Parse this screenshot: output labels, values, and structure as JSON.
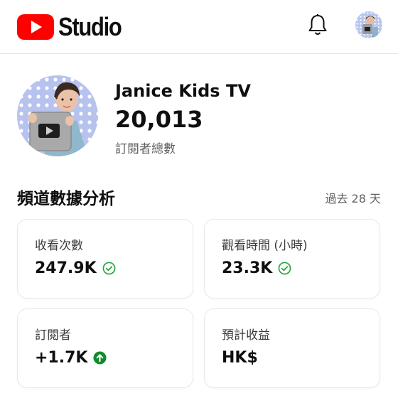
{
  "header": {
    "brand_label": "Studio",
    "logo_icon": "youtube-play-icon",
    "brand_color": "#ff0000",
    "notifications_icon": "bell-icon",
    "account_icon": "avatar"
  },
  "channel": {
    "name": "Janice Kids TV",
    "subscriber_count": "20,013",
    "subscriber_label": "訂閱者總數"
  },
  "analytics": {
    "title": "頻道數據分析",
    "period": "過去 28 天",
    "cards": [
      {
        "label": "收看次數",
        "value": "247.9K",
        "status_icon": "check-circle-icon",
        "status_color": "#2ba640"
      },
      {
        "label": "觀看時間 (小時)",
        "value": "23.3K",
        "status_icon": "check-circle-icon",
        "status_color": "#2ba640"
      },
      {
        "label": "訂閱者",
        "value": "+1.7K",
        "status_icon": "arrow-up-circle-icon",
        "status_color": "#0f8a2e"
      },
      {
        "label": "預計收益",
        "value": "HK$"
      }
    ]
  }
}
